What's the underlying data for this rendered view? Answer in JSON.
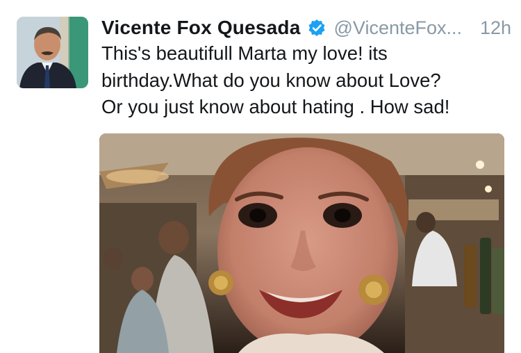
{
  "tweet": {
    "author_name": "Vicente Fox Quesada",
    "handle": "@VicenteFox...",
    "time": "12h",
    "text": "This's  beautifull Marta my love! its\nbirthday.What do you know about Love?\nOr you just know about hating . How sad!"
  },
  "icons": {
    "verified": "verified-badge-icon",
    "avatar": "profile-avatar",
    "photo": "attached-photo"
  },
  "colors": {
    "verified_blue": "#1da1f2",
    "muted_text": "#8899a6",
    "body_text": "#14171a"
  }
}
